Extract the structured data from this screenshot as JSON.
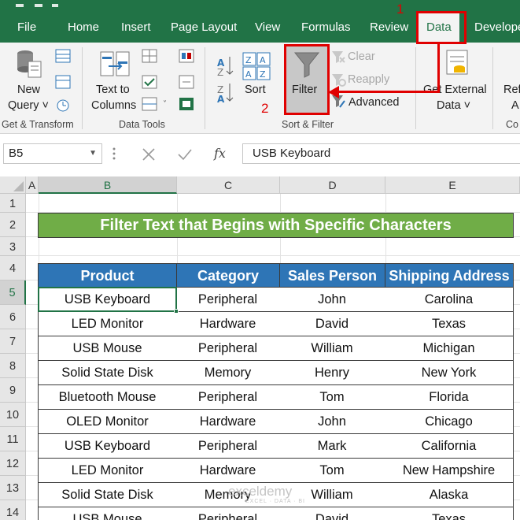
{
  "tabs": [
    {
      "label": "File"
    },
    {
      "label": "Home"
    },
    {
      "label": "Insert"
    },
    {
      "label": "Page Layout"
    },
    {
      "label": "View"
    },
    {
      "label": "Formulas"
    },
    {
      "label": "Review"
    },
    {
      "label": "Data"
    },
    {
      "label": "Develope"
    }
  ],
  "ribbon": {
    "new_query": {
      "line1": "New",
      "line2": "Query ˅"
    },
    "text_to_columns": {
      "line1": "Text to",
      "line2": "Columns"
    },
    "sort": {
      "label": "Sort"
    },
    "filter": {
      "label": "Filter"
    },
    "clear": {
      "label": "Clear"
    },
    "reapply": {
      "label": "Reapply"
    },
    "advanced": {
      "label": "Advanced"
    },
    "get_external": {
      "line1": "Get External",
      "line2": "Data ˅"
    },
    "refresh": {
      "line1": "Ref",
      "line2": "A"
    },
    "groups": {
      "get_transform": "Get & Transform",
      "data_tools": "Data Tools",
      "sort_filter": "Sort & Filter",
      "connections": "Co"
    }
  },
  "formula_bar": {
    "name_box": "B5",
    "fx": "fx",
    "value": "USB Keyboard"
  },
  "grid": {
    "columns": [
      "A",
      "B",
      "C",
      "D",
      "E"
    ],
    "rows": [
      "1",
      "2",
      "3",
      "4",
      "5",
      "6",
      "7",
      "8",
      "9",
      "10",
      "11",
      "12",
      "13",
      "14"
    ],
    "title": "Filter Text that Begins with Specific Characters",
    "headers": [
      "Product",
      "Category",
      "Sales Person",
      "Shipping Address"
    ],
    "data": [
      [
        "USB Keyboard",
        "Peripheral",
        "John",
        "Carolina"
      ],
      [
        "LED Monitor",
        "Hardware",
        "David",
        "Texas"
      ],
      [
        "USB Mouse",
        "Peripheral",
        "William",
        "Michigan"
      ],
      [
        "Solid State Disk",
        "Memory",
        "Henry",
        "New York"
      ],
      [
        "Bluetooth Mouse",
        "Peripheral",
        "Tom",
        "Florida"
      ],
      [
        "OLED Monitor",
        "Hardware",
        "John",
        "Chicago"
      ],
      [
        "USB Keyboard",
        "Peripheral",
        "Mark",
        "California"
      ],
      [
        "LED Monitor",
        "Hardware",
        "Tom",
        "New Hampshire"
      ],
      [
        "Solid State Disk",
        "Memory",
        "William",
        "Alaska"
      ],
      [
        "USB Mouse",
        "Peripheral",
        "David",
        "Texas"
      ]
    ]
  },
  "annotations": {
    "step1": "1",
    "step2": "2"
  },
  "watermark": {
    "name": "exceldemy",
    "tagline": "EXCEL · DATA · BI"
  },
  "colors": {
    "excel_green": "#217346",
    "title_green": "#70ad47",
    "header_blue": "#2e75b6",
    "annotation_red": "#e00000"
  }
}
